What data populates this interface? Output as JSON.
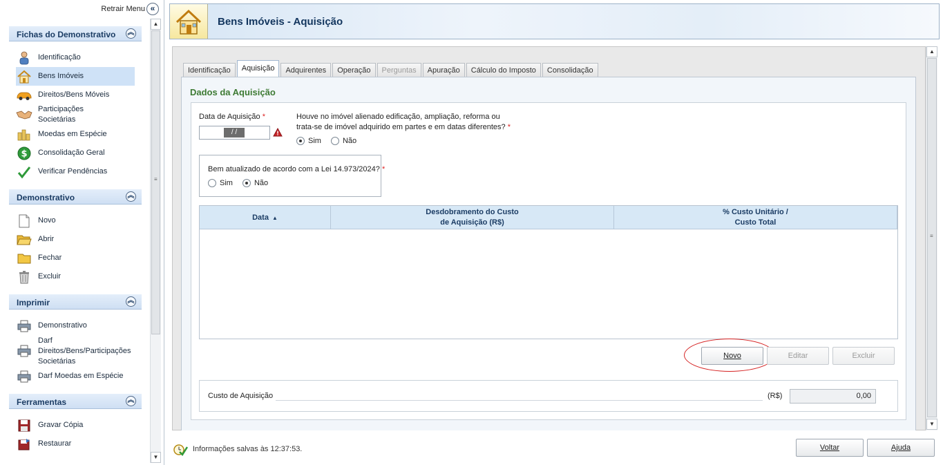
{
  "sidebar": {
    "retract_label": "Retrair Menu",
    "sections": [
      {
        "title": "Fichas do Demonstrativo",
        "items": [
          {
            "label": "Identificação",
            "icon": "person-icon"
          },
          {
            "label": "Bens Imóveis",
            "icon": "house-icon",
            "selected": true
          },
          {
            "label": "Direitos/Bens Móveis",
            "icon": "car-icon"
          },
          {
            "label": "Participações Societárias",
            "icon": "handshake-icon"
          },
          {
            "label": "Moedas em Espécie",
            "icon": "coins-icon"
          },
          {
            "label": "Consolidação Geral",
            "icon": "dollar-icon"
          },
          {
            "label": "Verificar Pendências",
            "icon": "checkmark-icon"
          }
        ]
      },
      {
        "title": "Demonstrativo",
        "items": [
          {
            "label": "Novo",
            "icon": "new-document-icon"
          },
          {
            "label": "Abrir",
            "icon": "open-folder-icon"
          },
          {
            "label": "Fechar",
            "icon": "folder-icon"
          },
          {
            "label": "Excluir",
            "icon": "trash-icon"
          }
        ]
      },
      {
        "title": "Imprimir",
        "items": [
          {
            "label": "Demonstrativo",
            "icon": "printer-icon"
          },
          {
            "label": "Darf Direitos/Bens/Participações Societárias",
            "icon": "printer-icon"
          },
          {
            "label": "Darf Moedas em Espécie",
            "icon": "printer-icon"
          }
        ]
      },
      {
        "title": "Ferramentas",
        "items": [
          {
            "label": "Gravar Cópia",
            "icon": "save-icon"
          },
          {
            "label": "Restaurar",
            "icon": "restore-icon"
          }
        ]
      }
    ]
  },
  "header": {
    "title": "Bens Imóveis - Aquisição"
  },
  "tabs": [
    {
      "label": "Identificação",
      "state": "normal"
    },
    {
      "label": "Aquisição",
      "state": "active"
    },
    {
      "label": "Adquirentes",
      "state": "normal"
    },
    {
      "label": "Operação",
      "state": "normal"
    },
    {
      "label": "Perguntas",
      "state": "disabled"
    },
    {
      "label": "Apuração",
      "state": "normal"
    },
    {
      "label": "Cálculo do Imposto",
      "state": "normal"
    },
    {
      "label": "Consolidação",
      "state": "normal"
    }
  ],
  "form": {
    "section_title": "Dados da Aquisição",
    "date_label": "Data de Aquisição",
    "date_value": " /  /",
    "required_mark": "*",
    "question1_line1": "Houve no imóvel alienado edificação, ampliação, reforma ou",
    "question1_line2": "trata-se de imóvel adquirido em partes e em datas diferentes?",
    "yes": "Sim",
    "no": "Não",
    "question1_selected": "Sim",
    "question2": "Bem atualizado de acordo com a Lei 14.973/2024?",
    "question2_selected": "Não",
    "grid": {
      "columns": [
        {
          "label": "Data",
          "sort": "asc"
        },
        {
          "label_line1": "Desdobramento do Custo",
          "label_line2": "de Aquisição (R$)"
        },
        {
          "label_line1": "% Custo Unitário /",
          "label_line2": "Custo Total"
        }
      ],
      "rows": []
    },
    "buttons": {
      "novo": "Novo",
      "editar": "Editar",
      "excluir": "Excluir"
    },
    "cost_label": "Custo de Aquisição",
    "cost_unit": "(R$)",
    "cost_value": "0,00"
  },
  "footer": {
    "status": "Informações salvas às 12:37:53.",
    "voltar": "Voltar",
    "ajuda": "Ajuda"
  },
  "colors": {
    "accent": "#12355e",
    "section_title": "#3d7a33",
    "highlight_circle": "#d52020"
  }
}
